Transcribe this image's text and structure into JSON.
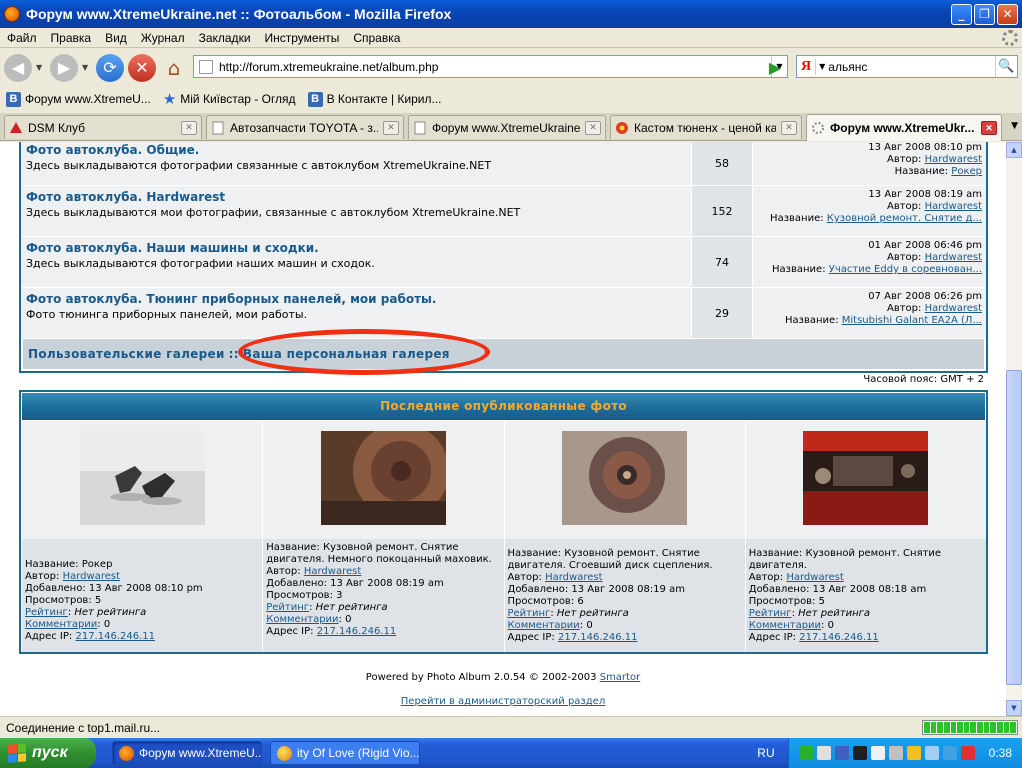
{
  "window": {
    "title": "Форум www.XtremeUkraine.net :: Фотоальбом - Mozilla Firefox"
  },
  "menu": [
    "Файл",
    "Правка",
    "Вид",
    "Журнал",
    "Закладки",
    "Инструменты",
    "Справка"
  ],
  "navigation": {
    "url": "http://forum.xtremeukraine.net/album.php",
    "search_engine": "Я",
    "search_value": "альянс"
  },
  "bookmarks": [
    {
      "label": "Форум www.XtremeU...",
      "icon": "vk-icon"
    },
    {
      "label": "Мій Київстар - Огляд",
      "icon": "star-icon"
    },
    {
      "label": "В Контакте | Кирил...",
      "icon": "vk-icon"
    }
  ],
  "tabs": [
    {
      "label": "DSM Клуб",
      "icon": "dsm-icon",
      "active": false
    },
    {
      "label": "Автозапчасти TOYOTA - з...",
      "icon": "page-icon",
      "active": false
    },
    {
      "label": "Форум www.XtremeUkraine...",
      "icon": "page-icon",
      "active": false
    },
    {
      "label": "Кастом тюненх - ценой ка...",
      "icon": "custom-icon",
      "active": false
    },
    {
      "label": "Форум www.XtremeUkr...",
      "icon": "loading-icon",
      "active": true
    }
  ],
  "forum": {
    "rows": [
      {
        "name": "Фото автоклуба. Общие.",
        "desc": "Здесь выкладываются фотографии связанные с автоклубом XtremeUkraine.NET",
        "count": "58",
        "date": "13 Авг 2008 08:10 pm",
        "author_label": "Автор:",
        "author": "Hardwarest",
        "title_label": "Название:",
        "title": "Рокер"
      },
      {
        "name": "Фото автоклуба. Hardwarest",
        "desc": "Здесь выкладываются мои фотографии, связанные с автоклубом XtremeUkraine.NET",
        "count": "152",
        "date": "13 Авг 2008 08:19 am",
        "author_label": "Автор:",
        "author": "Hardwarest",
        "title_label": "Название:",
        "title": "Кузовной ремонт. Снятие д..."
      },
      {
        "name": "Фото автоклуба. Наши машины и сходки.",
        "desc": "Здесь выкладываются фотографии наших машин и сходок.",
        "count": "74",
        "date": "01 Авг 2008 06:46 pm",
        "author_label": "Автор:",
        "author": "Hardwarest",
        "title_label": "Название:",
        "title": "Участие Eddy в соревнован..."
      },
      {
        "name": "Фото автоклуба. Тюнинг приборных панелей, мои работы.",
        "desc": "Фото тюнинга приборных панелей, мои работы.",
        "count": "29",
        "date": "07 Авг 2008 06:26 pm",
        "author_label": "Автор:",
        "author": "Hardwarest",
        "title_label": "Название:",
        "title": "Mitsubishi Galant EA2A (Л..."
      }
    ],
    "nav_user_galleries": "Пользовательские галереи",
    "nav_separator": "::",
    "nav_personal_gallery": "Ваша персональная галерея",
    "timezone": "Часовой пояс: GMT + 2"
  },
  "recent": {
    "header": "Последние опубликованные фото",
    "labels": {
      "name": "Название:",
      "author": "Автор:",
      "added": "Добавлено:",
      "views": "Просмотров:",
      "rating": "Рейтинг",
      "comments": "Комментарии",
      "ip": "Адрес IP:"
    },
    "items": [
      {
        "name": "Рокер",
        "author": "Hardwarest",
        "added": "13 Авг 2008 08:10 pm",
        "views": "5",
        "rating": "Нет рейтинга",
        "comments": "0",
        "ip": "217.146.246.11",
        "photo": "rocker-parts"
      },
      {
        "name": "Кузовной ремонт. Снятие двигателя. Немного покоцанный маховик.",
        "author": "Hardwarest",
        "added": "13 Авг 2008 08:19 am",
        "views": "3",
        "rating": "Нет рейтинга",
        "comments": "0",
        "ip": "217.146.246.11",
        "photo": "flywheel"
      },
      {
        "name": "Кузовной ремонт. Снятие двигателя. Сгоевший диск сцепления.",
        "author": "Hardwarest",
        "added": "13 Авг 2008 08:19 am",
        "views": "6",
        "rating": "Нет рейтинга",
        "comments": "0",
        "ip": "217.146.246.11",
        "photo": "clutch-disc"
      },
      {
        "name": "Кузовной ремонт. Снятие двигателя.",
        "author": "Hardwarest",
        "added": "13 Авг 2008 08:18 am",
        "views": "5",
        "rating": "Нет рейтинга",
        "comments": "0",
        "ip": "217.146.246.11",
        "photo": "engine-bay"
      }
    ]
  },
  "footer": {
    "powered_prefix": "Powered by Photo Album 2.0.54 © 2002-2003",
    "powered_link": "Smartor",
    "admin_link": "Перейти в администраторский раздел"
  },
  "status": {
    "text": "Соединение с top1.mail.ru...",
    "progress_segments": 14
  },
  "taskbar": {
    "start": "пуск",
    "tasks": [
      {
        "label": "Форум www.XtremeU...",
        "active": true
      },
      {
        "label": "ity Of Love (Rigid Vio...",
        "active": false
      }
    ],
    "lang": "RU",
    "clock": "0:38"
  },
  "colors": {
    "accent_border": "#1e6a8a",
    "link": "#1a5a8a",
    "header_text": "#f8a828",
    "highlight_circle": "#f03010"
  }
}
